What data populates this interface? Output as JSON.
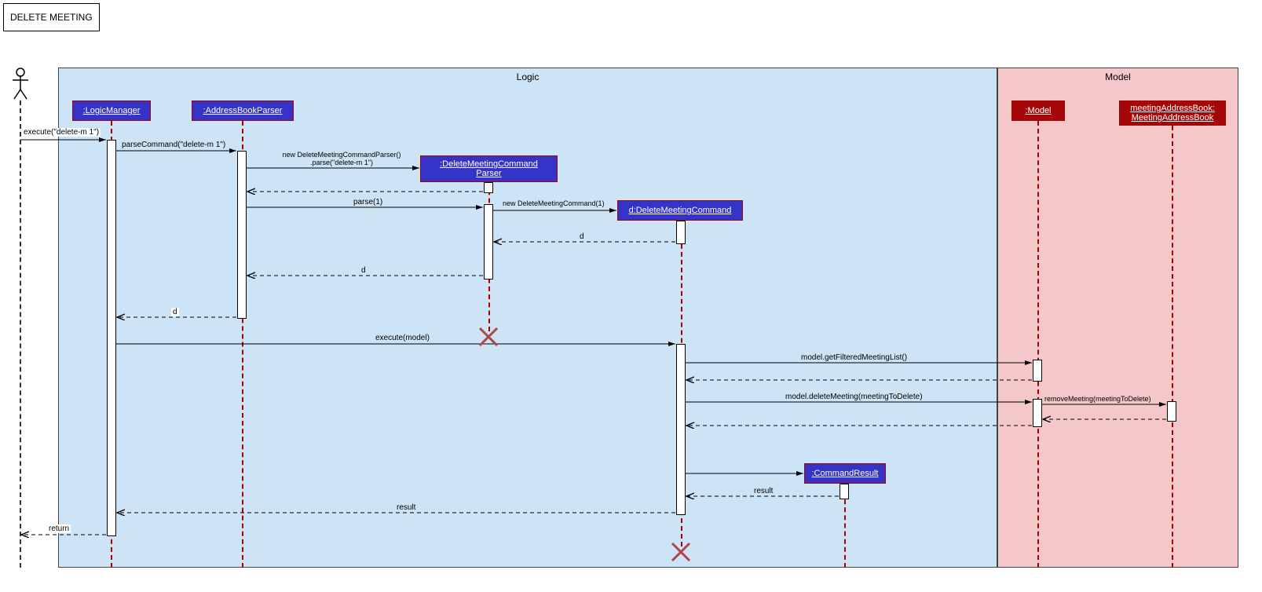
{
  "title": "DELETE MEETING",
  "frames": {
    "logic": "Logic",
    "model": "Model"
  },
  "objects": {
    "logicManager": ":LogicManager",
    "addressBookParser": ":AddressBookParser",
    "deleteMeetingCommandParser": ":DeleteMeetingCommand\nParser",
    "deleteMeetingCommand": "d:DeleteMeetingCommand",
    "commandResult": ":CommandResult",
    "model": ":Model",
    "meetingAddressBook": "meetingAddressBook:\nMeetingAddressBook"
  },
  "messages": {
    "execute": "execute(\"delete-m 1\")",
    "parseCommand": "parseCommand(\"delete-m 1\")",
    "newParser": "new DeleteMeetingCommandParser()\n.parse(\"delete-m 1\")",
    "parse1": "parse(1)",
    "newDeleteCmd": "new DeleteMeetingCommand(1)",
    "d_return1": "d",
    "d_return2": "d",
    "d_return3": "d",
    "executeModel": "execute(model)",
    "getFilteredList": "model.getFilteredMeetingList()",
    "deleteMeeting": "model.deleteMeeting(meetingToDelete)",
    "removeMeeting": "removeMeeting(meetingToDelete)",
    "result1": "result",
    "result2": "result",
    "returnFinal": "return"
  },
  "chart_data": {
    "type": "sequence_diagram",
    "title": "DELETE MEETING",
    "frames": [
      {
        "name": "Logic",
        "participants": [
          "LogicManager",
          "AddressBookParser",
          "DeleteMeetingCommandParser",
          "d:DeleteMeetingCommand",
          "CommandResult"
        ]
      },
      {
        "name": "Model",
        "participants": [
          "Model",
          "meetingAddressBook:MeetingAddressBook"
        ]
      }
    ],
    "participants": [
      "Actor",
      ":LogicManager",
      ":AddressBookParser",
      ":DeleteMeetingCommandParser",
      "d:DeleteMeetingCommand",
      ":CommandResult",
      ":Model",
      "meetingAddressBook:MeetingAddressBook"
    ],
    "messages": [
      {
        "from": "Actor",
        "to": ":LogicManager",
        "label": "execute(\"delete-m 1\")",
        "type": "sync"
      },
      {
        "from": ":LogicManager",
        "to": ":AddressBookParser",
        "label": "parseCommand(\"delete-m 1\")",
        "type": "sync"
      },
      {
        "from": ":AddressBookParser",
        "to": ":DeleteMeetingCommandParser",
        "label": "new DeleteMeetingCommandParser().parse(\"delete-m 1\")",
        "type": "create"
      },
      {
        "from": ":DeleteMeetingCommandParser",
        "to": ":AddressBookParser",
        "label": "",
        "type": "return"
      },
      {
        "from": ":AddressBookParser",
        "to": ":DeleteMeetingCommandParser",
        "label": "parse(1)",
        "type": "sync"
      },
      {
        "from": ":DeleteMeetingCommandParser",
        "to": "d:DeleteMeetingCommand",
        "label": "new DeleteMeetingCommand(1)",
        "type": "create"
      },
      {
        "from": "d:DeleteMeetingCommand",
        "to": ":DeleteMeetingCommandParser",
        "label": "d",
        "type": "return"
      },
      {
        "from": ":DeleteMeetingCommandParser",
        "to": ":AddressBookParser",
        "label": "d",
        "type": "return"
      },
      {
        "from": ":DeleteMeetingCommandParser",
        "to": null,
        "label": "",
        "type": "destroy"
      },
      {
        "from": ":AddressBookParser",
        "to": ":LogicManager",
        "label": "d",
        "type": "return"
      },
      {
        "from": ":LogicManager",
        "to": "d:DeleteMeetingCommand",
        "label": "execute(model)",
        "type": "sync"
      },
      {
        "from": "d:DeleteMeetingCommand",
        "to": ":Model",
        "label": "model.getFilteredMeetingList()",
        "type": "sync"
      },
      {
        "from": ":Model",
        "to": "d:DeleteMeetingCommand",
        "label": "",
        "type": "return"
      },
      {
        "from": "d:DeleteMeetingCommand",
        "to": ":Model",
        "label": "model.deleteMeeting(meetingToDelete)",
        "type": "sync"
      },
      {
        "from": ":Model",
        "to": "meetingAddressBook:MeetingAddressBook",
        "label": "removeMeeting(meetingToDelete)",
        "type": "sync"
      },
      {
        "from": "meetingAddressBook:MeetingAddressBook",
        "to": ":Model",
        "label": "",
        "type": "return"
      },
      {
        "from": ":Model",
        "to": "d:DeleteMeetingCommand",
        "label": "",
        "type": "return"
      },
      {
        "from": "d:DeleteMeetingCommand",
        "to": ":CommandResult",
        "label": "",
        "type": "create"
      },
      {
        "from": ":CommandResult",
        "to": "d:DeleteMeetingCommand",
        "label": "result",
        "type": "return"
      },
      {
        "from": "d:DeleteMeetingCommand",
        "to": ":LogicManager",
        "label": "result",
        "type": "return"
      },
      {
        "from": "d:DeleteMeetingCommand",
        "to": null,
        "label": "",
        "type": "destroy"
      },
      {
        "from": ":LogicManager",
        "to": "Actor",
        "label": "return",
        "type": "return"
      }
    ]
  }
}
